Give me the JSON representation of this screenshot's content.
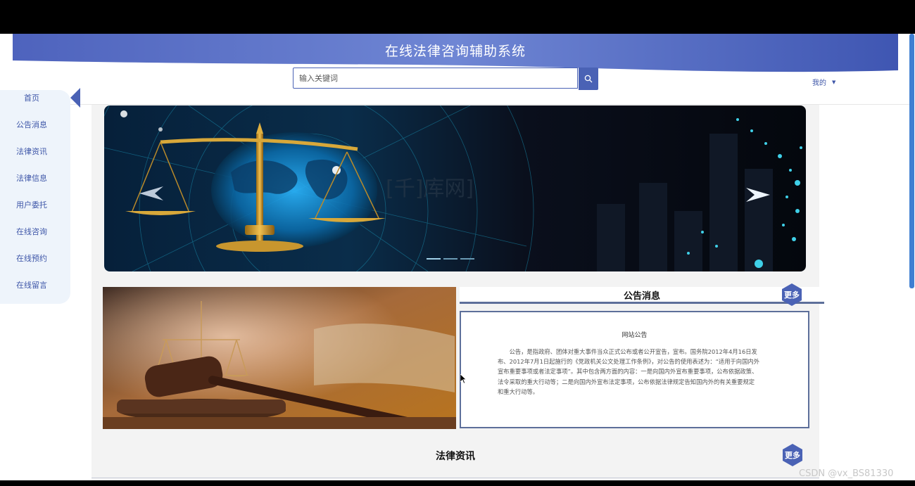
{
  "header": {
    "title": "在线法律咨询辅助系统",
    "search_placeholder": "输入关键词",
    "user_menu_label": "我的"
  },
  "sidebar": {
    "items": [
      {
        "label": "首页",
        "active": true
      },
      {
        "label": "公告消息"
      },
      {
        "label": "法律资讯"
      },
      {
        "label": "法律信息"
      },
      {
        "label": "用户委托"
      },
      {
        "label": "在线咨询"
      },
      {
        "label": "在线预约"
      },
      {
        "label": "在线留言"
      }
    ]
  },
  "banner": {
    "slide_count": 3,
    "active_slide": 1
  },
  "notice": {
    "section_title": "公告消息",
    "more_label": "更多",
    "item_title": "网站公告",
    "item_body": "公告，是指政府、团体对重大事件当众正式公布或者公开宣告，宣布。国务院2012年4月16日发布、2012年7月1日起施行的《党政机关公文处理工作条例》，对公告的使用表述为：“适用于向国内外宣布重要事项或者法定事项”。其中包含两方面的内容：一是向国内外宣布重要事项，公布依据政策、法令采取的重大行动等；二是向国内外宣布法定事项，公布依据法律规定告知国内外的有关重要规定和重大行动等。"
  },
  "law_news": {
    "section_title": "法律资讯",
    "more_label": "更多"
  },
  "watermark": "CSDN @vx_BS81330",
  "colors": {
    "primary": "#4a62b5",
    "sidebar_bg": "#eef4fb",
    "content_bg": "#f3f3f3",
    "notice_border": "#5d6f9a"
  }
}
